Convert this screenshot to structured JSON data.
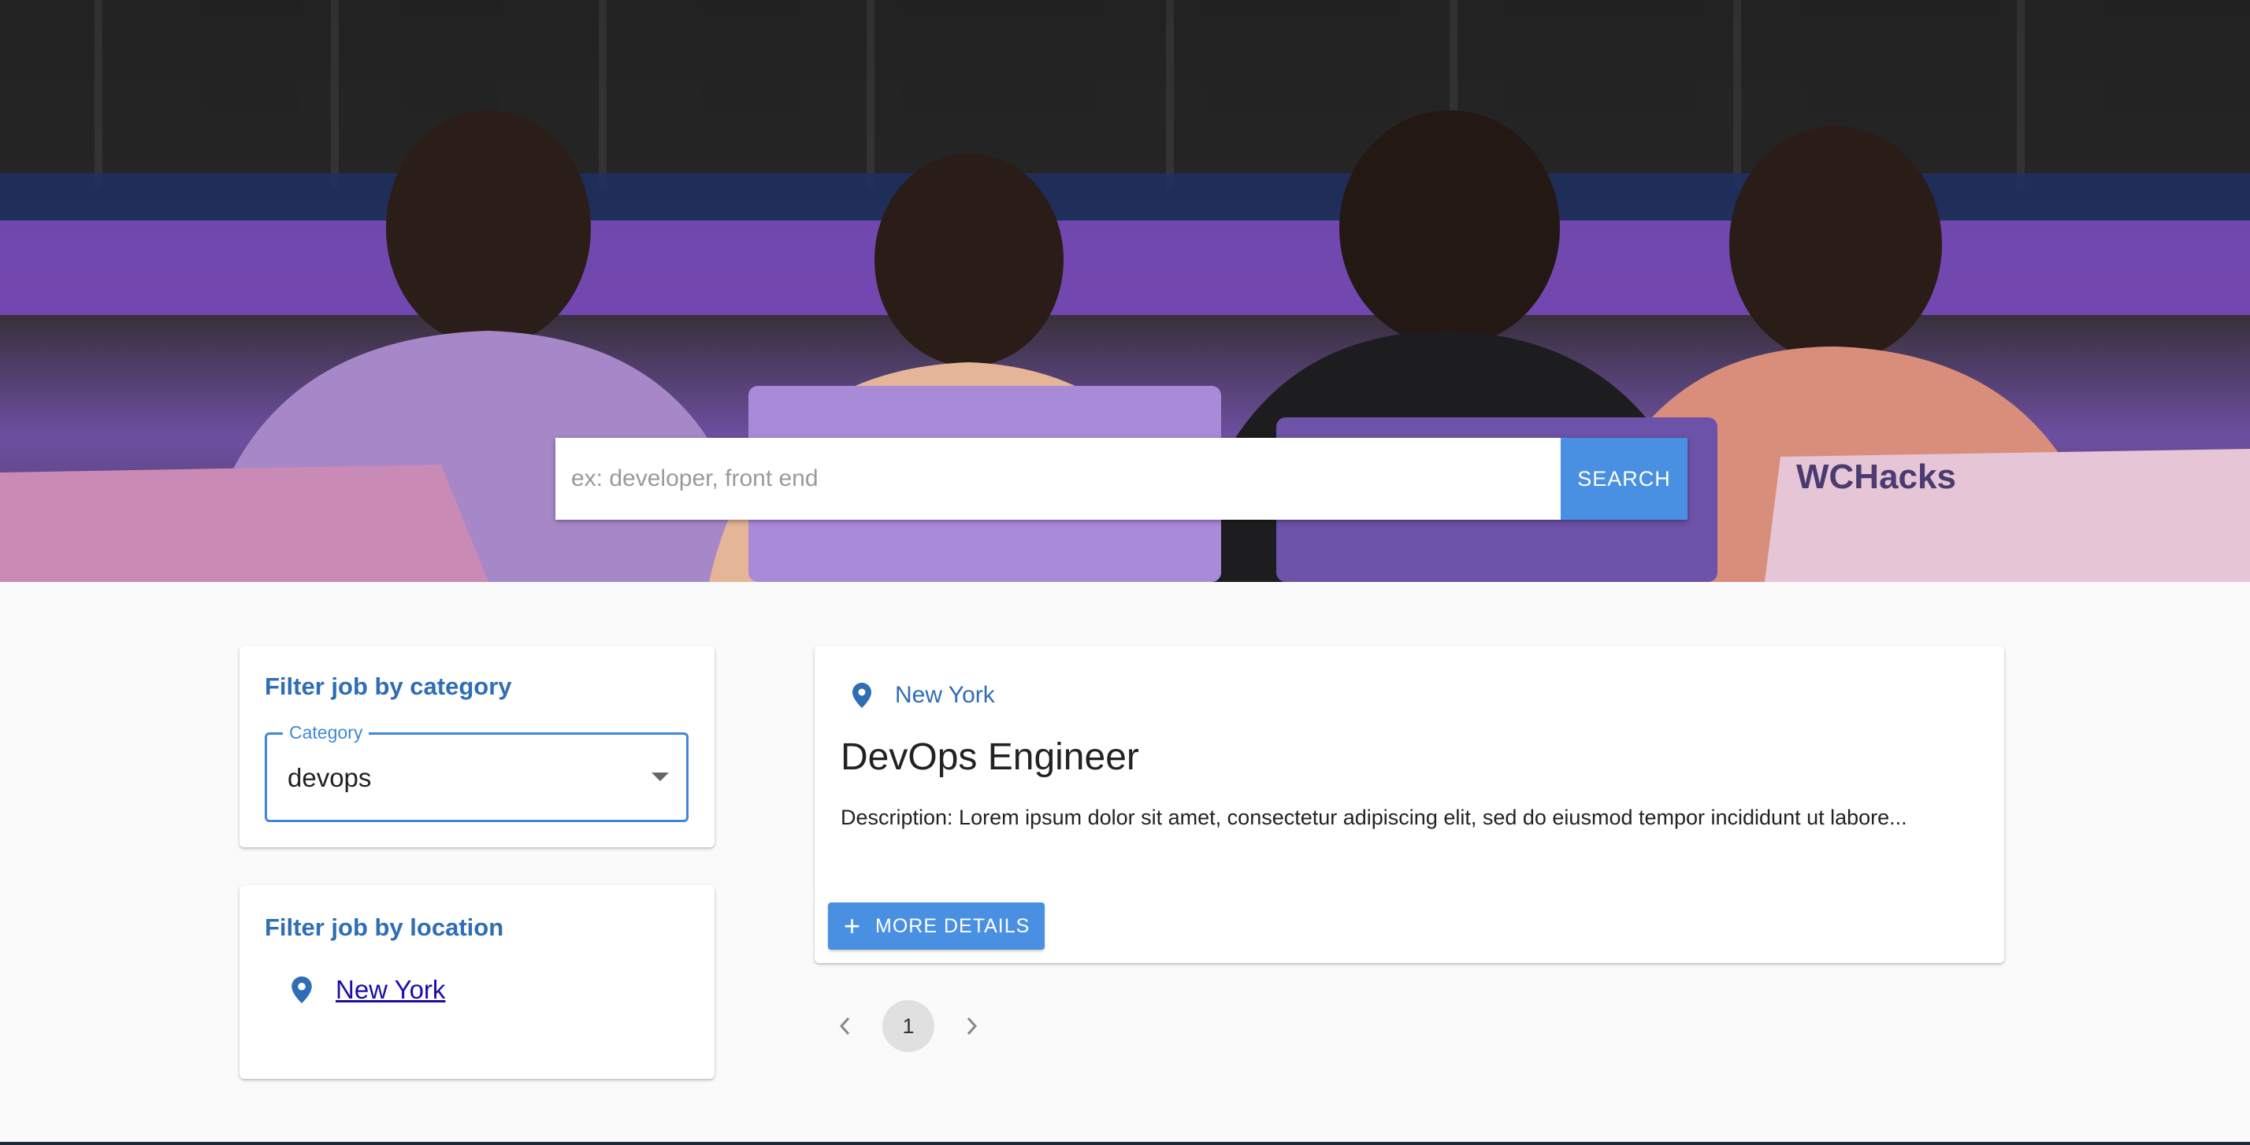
{
  "search": {
    "placeholder": "ex: developer, front end",
    "button_label": "SEARCH"
  },
  "category_filter": {
    "title": "Filter job by category",
    "select_label": "Category",
    "selected_value": "devops"
  },
  "location_filter": {
    "title": "Filter job by location",
    "items": [
      {
        "label": "New York"
      }
    ]
  },
  "jobs": [
    {
      "location": "New York",
      "title": "DevOps Engineer",
      "description": "Description: Lorem ipsum dolor sit amet, consectetur adipiscing elit, sed do eiusmod tempor incididunt ut labore...",
      "button_label": "MORE DETAILS"
    }
  ],
  "pagination": {
    "current_page": "1",
    "prev_icon": "chevron-left-icon",
    "next_icon": "chevron-right-icon"
  },
  "colors": {
    "accent": "#4a90e2",
    "title_blue": "#2f6db5",
    "link": "#1a0dab",
    "background": "#fafafa"
  }
}
